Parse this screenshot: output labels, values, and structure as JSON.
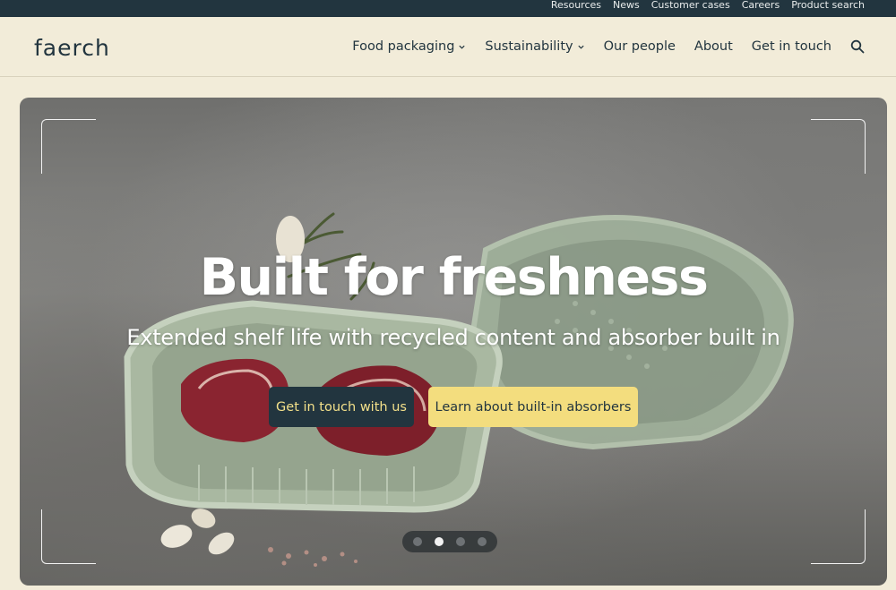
{
  "utility_nav": [
    "Resources",
    "News",
    "Customer cases",
    "Careers",
    "Product search"
  ],
  "logo": "faerch",
  "main_nav": {
    "items": [
      {
        "label": "Food packaging",
        "dropdown": true
      },
      {
        "label": "Sustainability",
        "dropdown": true
      },
      {
        "label": "Our people",
        "dropdown": false
      },
      {
        "label": "About",
        "dropdown": false
      },
      {
        "label": "Get in touch",
        "dropdown": false
      }
    ],
    "search_icon": "search-icon"
  },
  "hero": {
    "title": "Built for freshness",
    "subtitle": "Extended shelf life with recycled content and absorber built in",
    "primary_button": "Get in touch with us",
    "secondary_button": "Learn about built-in absorbers",
    "carousel": {
      "slide_count": 4,
      "active_index": 1
    }
  },
  "colors": {
    "brand_dark": "#22353f",
    "background": "#f2ecd9",
    "accent_yellow": "#f3dd7e"
  }
}
